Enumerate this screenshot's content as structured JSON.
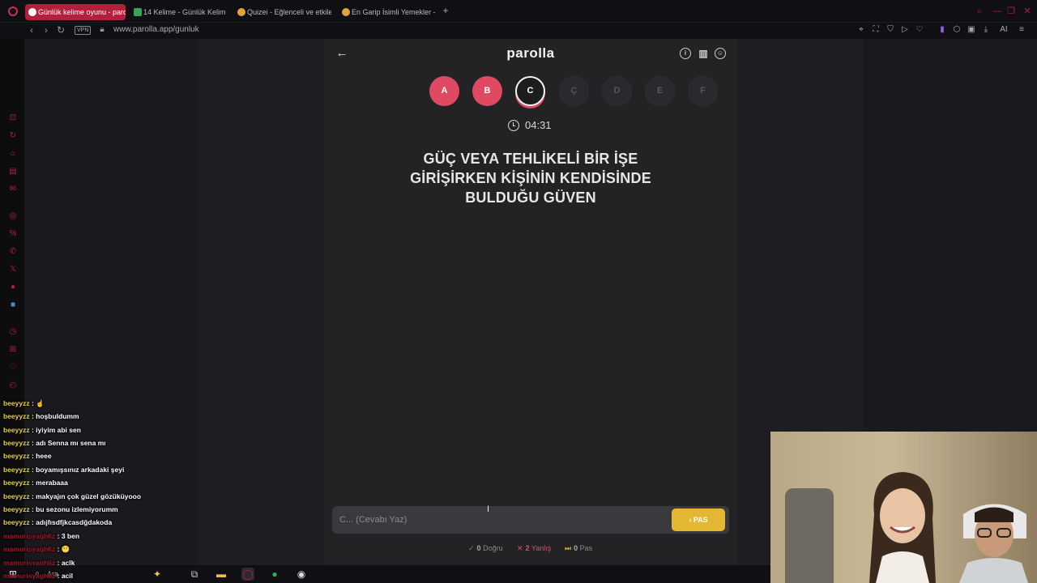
{
  "browser": {
    "tabs": [
      {
        "title": "Günlük kelime oyunu - parolla",
        "active": true
      },
      {
        "title": "14 Kelime - Günlük Kelime Oyunu",
        "active": false
      },
      {
        "title": "Quizei - Eğlenceli ve etkileşimli",
        "active": false
      },
      {
        "title": "En Garip İsimli Yemekler - Quizei",
        "active": false
      }
    ],
    "new_tab_symbol": "+",
    "vpn_label": "VPN",
    "url": "www.parolla.app/gunluk",
    "ai_label": "AI"
  },
  "game": {
    "logo": "parolla",
    "letters": [
      {
        "label": "A",
        "state": "done"
      },
      {
        "label": "B",
        "state": "done"
      },
      {
        "label": "C",
        "state": "current"
      },
      {
        "label": "Ç",
        "state": "pending"
      },
      {
        "label": "D",
        "state": "pending"
      },
      {
        "label": "E",
        "state": "pending"
      },
      {
        "label": "F",
        "state": "pending"
      }
    ],
    "timer": "04:31",
    "question_lines": [
      "GÜÇ VEYA TEHLİKELİ BİR İŞE",
      "GİRİŞİRKEN KİŞİNİN KENDİSİNDE",
      "BULDUĞU GÜVEN"
    ],
    "answer_placeholder": "C... (Cevabı Yaz)",
    "pass_button": "PAS",
    "stats": {
      "correct_count": "0",
      "correct_label": "Doğru",
      "wrong_count": "2",
      "wrong_label": "Yanlış",
      "pass_count": "0",
      "pass_label": "Pas"
    }
  },
  "chat": [
    {
      "user": "beeyyzz",
      "message": "☝",
      "user_color": "yellow"
    },
    {
      "user": "beeyyzz",
      "message": "hoşbuldumm",
      "user_color": "yellow"
    },
    {
      "user": "beeyyzz",
      "message": "iyiyim abi sen",
      "user_color": "yellow"
    },
    {
      "user": "beeyyzz",
      "message": "adı Senna mı sena mı",
      "user_color": "yellow"
    },
    {
      "user": "beeyyzz",
      "message": "heee",
      "user_color": "yellow"
    },
    {
      "user": "beeyyzz",
      "message": "boyamışsınız arkadaki şeyi",
      "user_color": "yellow"
    },
    {
      "user": "beeyyzz",
      "message": "merabaaa",
      "user_color": "yellow"
    },
    {
      "user": "beeyyzz",
      "message": "makyajın çok güzel gözüküyooo",
      "user_color": "yellow"
    },
    {
      "user": "beeyyzz",
      "message": "bu sezonu izlemiyorumm",
      "user_color": "yellow"
    },
    {
      "user": "beeyyzz",
      "message": "adıjfısdfjkcasdğdakoda",
      "user_color": "yellow"
    },
    {
      "user": "mamurisyaghliz",
      "message": "3 ben",
      "user_color": "red"
    },
    {
      "user": "mamurisyaghliz",
      "message": "😬",
      "user_color": "red"
    },
    {
      "user": "mamurisyaghliz",
      "message": "aclk",
      "user_color": "red"
    },
    {
      "user": "mamurisyaghliz",
      "message": "acil",
      "user_color": "red"
    }
  ],
  "taskbar": {
    "search_label": "Ara"
  },
  "colors": {
    "accent_red": "#df4a62",
    "pass_yellow": "#e4b732",
    "opera_red": "#b3203c"
  }
}
